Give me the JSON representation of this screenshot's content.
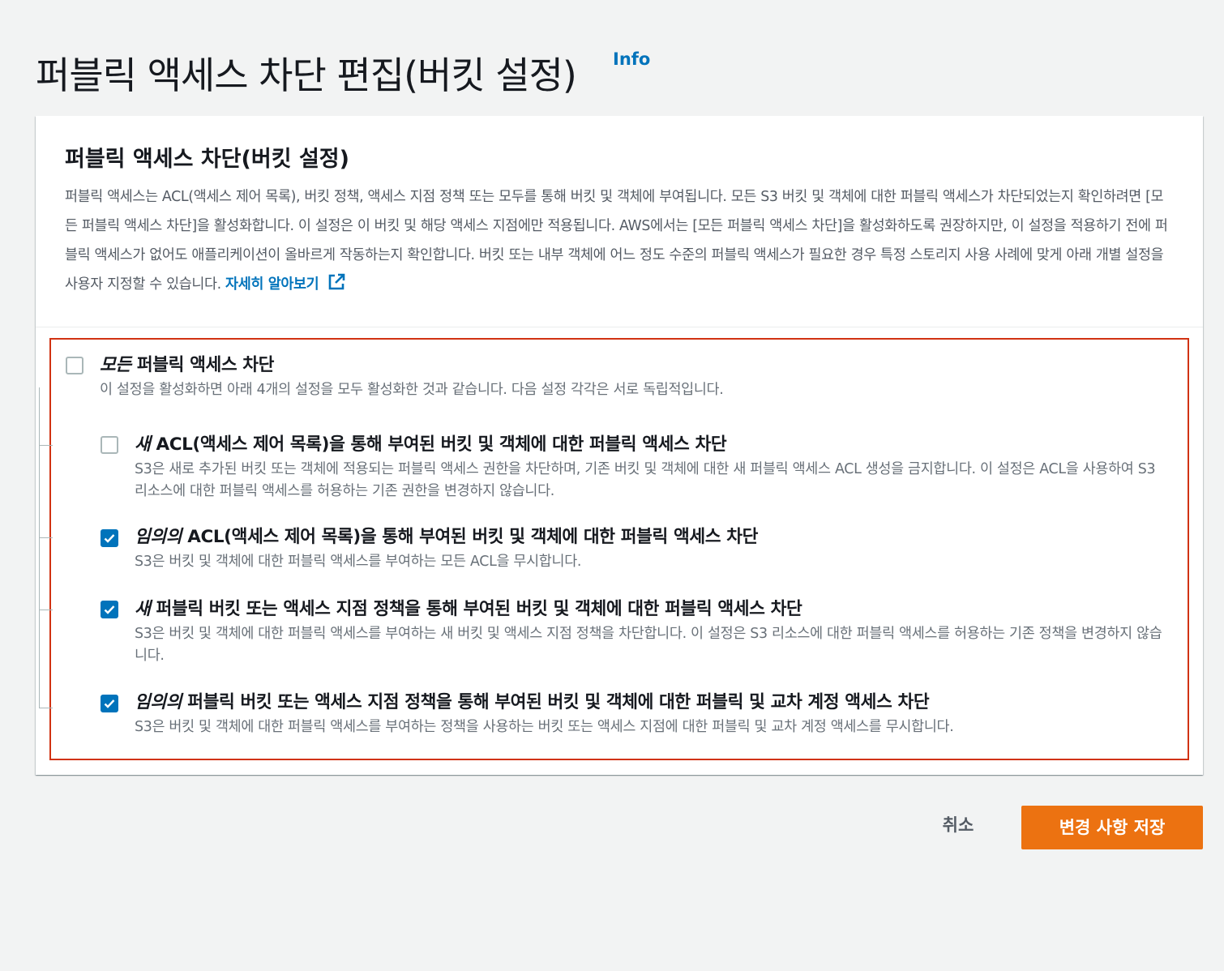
{
  "header": {
    "title": "퍼블릭 액세스 차단 편집(버킷 설정)",
    "info_label": "Info"
  },
  "panel": {
    "title": "퍼블릭 액세스 차단(버킷 설정)",
    "description": "퍼블릭 액세스는 ACL(액세스 제어 목록), 버킷 정책, 액세스 지점 정책 또는 모두를 통해 버킷 및 객체에 부여됩니다. 모든 S3 버킷 및 객체에 대한 퍼블릭 액세스가 차단되었는지 확인하려면 [모든 퍼블릭 액세스 차단]을 활성화합니다. 이 설정은 이 버킷 및 해당 액세스 지점에만 적용됩니다. AWS에서는 [모든 퍼블릭 액세스 차단]을 활성화하도록 권장하지만, 이 설정을 적용하기 전에 퍼블릭 액세스가 없어도 애플리케이션이 올바르게 작동하는지 확인합니다. 버킷 또는 내부 객체에 어느 정도 수준의 퍼블릭 액세스가 필요한 경우 특정 스토리지 사용 사례에 맞게 아래 개별 설정을 사용자 지정할 수 있습니다.",
    "learn_more": "자세히 알아보기"
  },
  "block_all": {
    "label_em": "모든",
    "label": " 퍼블릭 액세스 차단",
    "description": "이 설정을 활성화하면 아래 4개의 설정을 모두 활성화한 것과 같습니다. 다음 설정 각각은 서로 독립적입니다.",
    "checked": false
  },
  "options": [
    {
      "label_em": "새",
      "label": " ACL(액세스 제어 목록)을 통해 부여된 버킷 및 객체에 대한 퍼블릭 액세스 차단",
      "description": "S3은 새로 추가된 버킷 또는 객체에 적용되는 퍼블릭 액세스 권한을 차단하며, 기존 버킷 및 객체에 대한 새 퍼블릭 액세스 ACL 생성을 금지합니다. 이 설정은 ACL을 사용하여 S3 리소스에 대한 퍼블릭 액세스를 허용하는 기존 권한을 변경하지 않습니다.",
      "checked": false
    },
    {
      "label_em": "임의의",
      "label": " ACL(액세스 제어 목록)을 통해 부여된 버킷 및 객체에 대한 퍼블릭 액세스 차단",
      "description": "S3은 버킷 및 객체에 대한 퍼블릭 액세스를 부여하는 모든 ACL을 무시합니다.",
      "checked": true
    },
    {
      "label_em": "새",
      "label": " 퍼블릭 버킷 또는 액세스 지점 정책을 통해 부여된 버킷 및 객체에 대한 퍼블릭 액세스 차단",
      "description": "S3은 버킷 및 객체에 대한 퍼블릭 액세스를 부여하는 새 버킷 및 액세스 지점 정책을 차단합니다. 이 설정은 S3 리소스에 대한 퍼블릭 액세스를 허용하는 기존 정책을 변경하지 않습니다.",
      "checked": true
    },
    {
      "label_em": "임의의",
      "label": " 퍼블릭 버킷 또는 액세스 지점 정책을 통해 부여된 버킷 및 객체에 대한 퍼블릭 및 교차 계정 액세스 차단",
      "description": "S3은 버킷 및 객체에 대한 퍼블릭 액세스를 부여하는 정책을 사용하는 버킷 또는 액세스 지점에 대한 퍼블릭 및 교차 계정 액세스를 무시합니다.",
      "checked": true
    }
  ],
  "footer": {
    "cancel_label": "취소",
    "save_label": "변경 사항 저장"
  },
  "colors": {
    "accent": "#0073bb",
    "primary_button": "#ec7211",
    "highlight_border": "#d13212",
    "background": "#f2f3f3"
  }
}
